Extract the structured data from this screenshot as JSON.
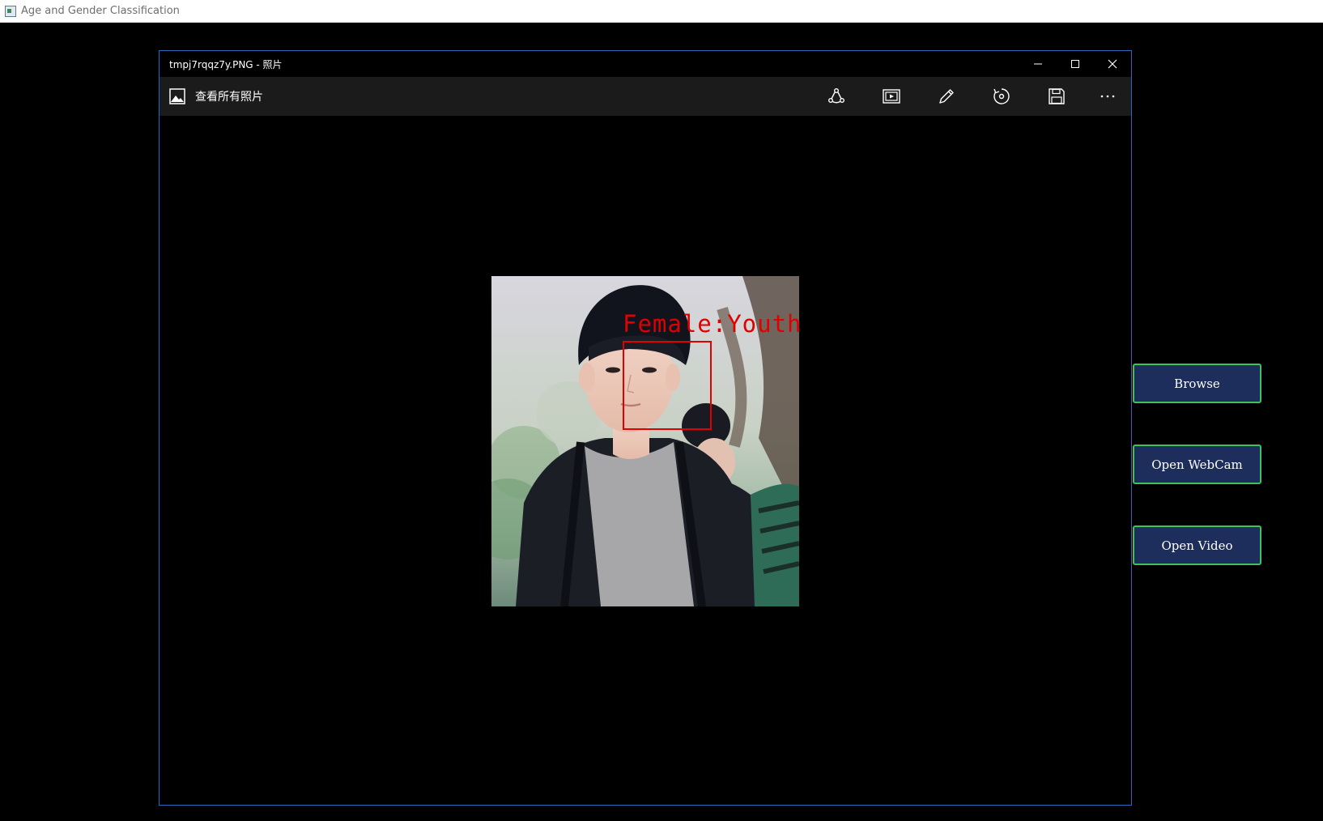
{
  "app": {
    "title": "Age and Gender Classification",
    "icon": "app-window-icon"
  },
  "viewer": {
    "title": "tmpj7rqqz7y.PNG - 照片",
    "window_controls": [
      "minimize-icon",
      "maximize-icon",
      "close-icon"
    ],
    "toolbar": {
      "see_all_label": "查看所有照片",
      "see_all_icon": "photo-gallery-icon",
      "icons": [
        "share-icon",
        "slideshow-icon",
        "edit-pencil-icon",
        "rotate-icon",
        "save-icon",
        "more-icon"
      ],
      "more_label": "···"
    },
    "photo": {
      "label": "Female:Youth",
      "label_color": "#e00000",
      "box_color": "#e00000"
    }
  },
  "actions": {
    "browse_label": "Browse",
    "webcam_label": "Open WebCam",
    "video_label": "Open Video",
    "button_bg": "#1d2d5c",
    "button_border": "#3cc35a"
  },
  "colors": {
    "viewer_border": "#2a69b8",
    "toolbar_bg": "#1b1b1b",
    "background": "#000000"
  }
}
